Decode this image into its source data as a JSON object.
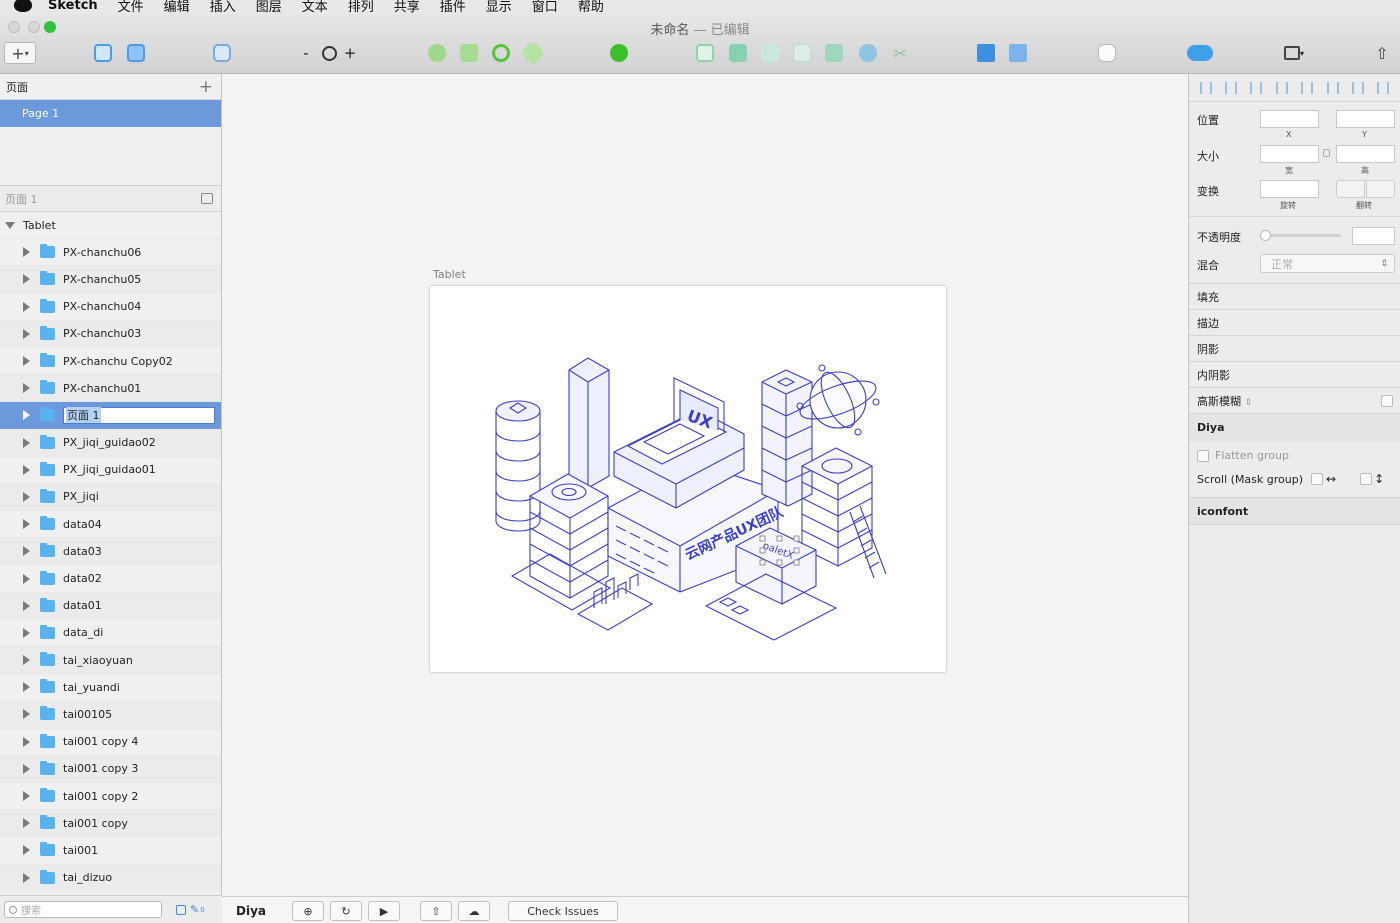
{
  "menubar": {
    "app": "Sketch",
    "items": [
      "文件",
      "编辑",
      "插入",
      "图层",
      "文本",
      "排列",
      "共享",
      "插件",
      "显示",
      "窗口",
      "帮助"
    ]
  },
  "window": {
    "title": "未命名",
    "status": "— 已编辑"
  },
  "toolbar": {
    "zoom_out": "-",
    "zoom_in": "+"
  },
  "pages": {
    "header": "页面",
    "add": "+",
    "items": [
      "Page 1"
    ]
  },
  "layers": {
    "header": "页面 1",
    "group": "Tablet",
    "rows": [
      "PX-chanchu06",
      "PX-chanchu05",
      "PX-chanchu04",
      "PX-chanchu03",
      "PX-chanchu Copy02",
      "PX-chanchu01",
      "页面 1",
      "PX_jiqi_guidao02",
      "PX_jiqi_guidao01",
      "PX_jiqi",
      "data04",
      "data03",
      "data02",
      "data01",
      "data_di",
      "tai_xiaoyuan",
      "tai_yuandi",
      "tai00105",
      "tai001 copy 4",
      "tai001 copy 3",
      "tai001 copy 2",
      "tai001 copy",
      "tai001",
      "tai_dizuo"
    ],
    "selected_index": 6
  },
  "search": {
    "placeholder": "搜索",
    "count": "0"
  },
  "canvas": {
    "artboard_name": "Tablet",
    "illus_text_sign": "云网产品UX团队",
    "illus_text_ux": "UX",
    "illus_text_robot": "paletX"
  },
  "bottombar": {
    "plugin": "Diya",
    "check": "Check Issues"
  },
  "inspector": {
    "position": "位置",
    "x": "X",
    "y": "Y",
    "size": "大小",
    "w": "宽",
    "h": "高",
    "transform": "变换",
    "rotate": "旋转",
    "flip": "翻转",
    "opacity": "不透明度",
    "blend": "混合",
    "blend_value": "正常",
    "fill": "填充",
    "border": "描边",
    "shadow": "阴影",
    "inner_shadow": "内阴影",
    "blur": "高斯模糊",
    "plugin_diya": "Diya",
    "flatten": "Flatten group",
    "scroll": "Scroll (Mask group)",
    "iconfont": "iconfont"
  },
  "colors": {
    "accent": "#6b99db",
    "folder": "#56b3f0",
    "illustration": "#3d3fc4"
  }
}
